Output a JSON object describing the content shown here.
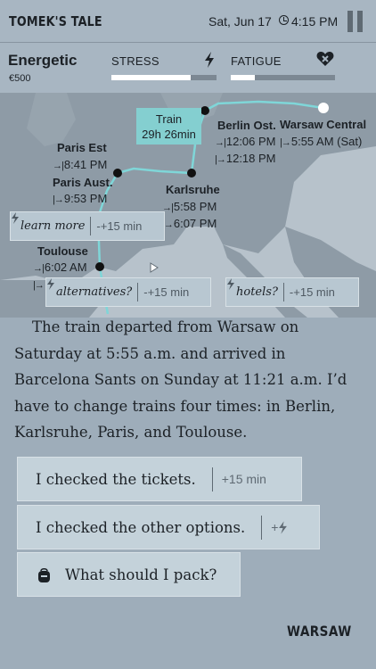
{
  "header": {
    "title": "TOMEK'S TALE",
    "date": "Sat, Jun 17",
    "time": "4:15 PM"
  },
  "status": {
    "mood": "Energetic",
    "money": "€500",
    "stress_label": "STRESS",
    "stress_level": 0.75,
    "fatigue_label": "FATIGUE",
    "fatigue_level": 0.23
  },
  "map": {
    "train": {
      "label": "Train",
      "duration": "29h 26min"
    },
    "stops": [
      {
        "city": "Warsaw Central",
        "depart": "5:55 AM (Sat)"
      },
      {
        "city": "Berlin Ost.",
        "arrive": "12:06 PM",
        "depart": "12:18 PM"
      },
      {
        "city": "Karlsruhe",
        "arrive": "5:58 PM",
        "depart": "6:07 PM"
      },
      {
        "city": "Paris Est",
        "arrive": "8:41 PM"
      },
      {
        "city": "Paris Aust.",
        "depart": "9:53 PM"
      },
      {
        "city": "Toulouse",
        "arrive": "6:02 AM"
      }
    ],
    "actions": {
      "learn_more": "learn more",
      "learn_more_cost": "+15 min",
      "alternatives": "alternatives?",
      "alternatives_cost": "+15 min",
      "hotels": "hotels?",
      "hotels_cost": "+15 min"
    }
  },
  "narrative": "The train departed from Warsaw on Saturday at 5:55 a.m. and arrived in Barcelona Sants on Sunday at 11:21 a.m. I’d have to change trains four times: in Berlin, Karlsruhe, Paris, and Toulouse.",
  "choices": [
    {
      "label": "I checked the tickets.",
      "cost": "+15 min"
    },
    {
      "label": "I checked the other options.",
      "cost": "+"
    },
    {
      "label": "What should I pack?",
      "icon": "backpack-icon"
    }
  ],
  "location": "WARSAW",
  "colors": {
    "accent": "#84cfd0",
    "route": "#7fd6d8",
    "background": "#9eadba"
  }
}
